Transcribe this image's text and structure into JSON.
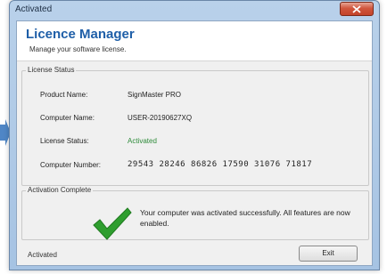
{
  "window": {
    "title": "Activated",
    "close_icon": "close-icon"
  },
  "header": {
    "title": "Licence Manager",
    "subtitle": "Manage your software license."
  },
  "license_status": {
    "legend": "License Status",
    "rows": [
      {
        "label": "Product Name:",
        "value": "SignMaster PRO"
      },
      {
        "label": "Computer Name:",
        "value": "USER-20190627XQ"
      },
      {
        "label": "License Status:",
        "value": "Activated"
      },
      {
        "label": "Computer Number:",
        "value": "29543 28246 86826 17590 31076 71817"
      }
    ]
  },
  "activation": {
    "legend": "Activation Complete",
    "icon": "checkmark-icon",
    "message": "Your computer was activated successfully. All features are now enabled."
  },
  "footer": {
    "status": "Activated",
    "exit_label": "Exit"
  },
  "colors": {
    "title_blue": "#1f5fa8",
    "activated_green": "#2e8b3a",
    "check_green": "#2f9e2f",
    "close_red": "#c3432a"
  }
}
